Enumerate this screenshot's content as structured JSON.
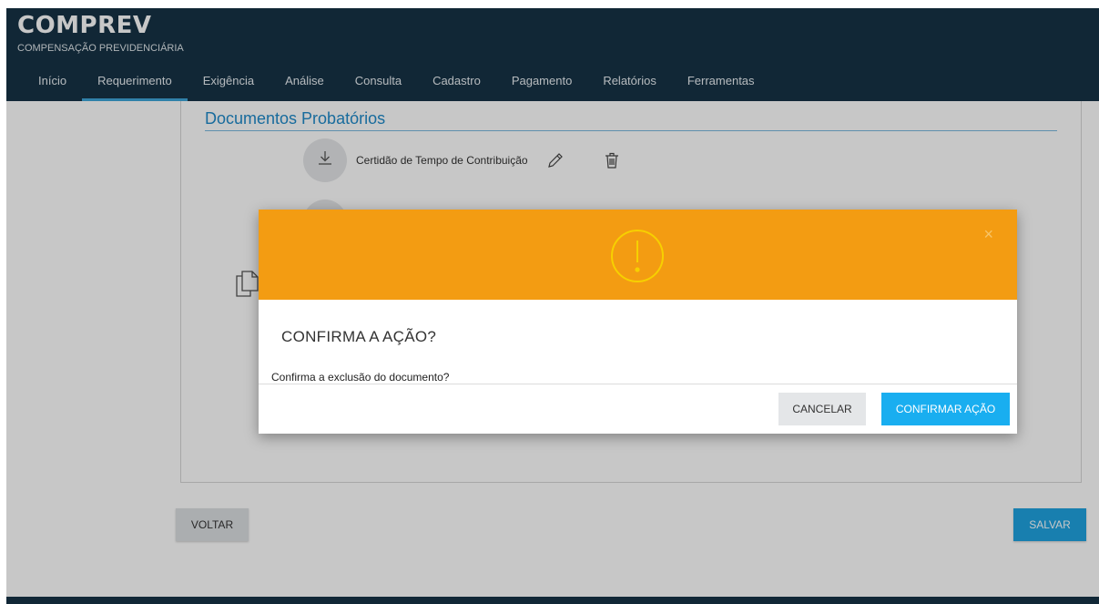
{
  "header": {
    "title": "COMPREV",
    "subtitle": "COMPENSAÇÃO PREVIDENCIÁRIA"
  },
  "nav": {
    "items": [
      {
        "label": "Início"
      },
      {
        "label": "Requerimento"
      },
      {
        "label": "Exigência"
      },
      {
        "label": "Análise"
      },
      {
        "label": "Consulta"
      },
      {
        "label": "Cadastro"
      },
      {
        "label": "Pagamento"
      },
      {
        "label": "Relatórios"
      },
      {
        "label": "Ferramentas"
      }
    ],
    "active": "Requerimento"
  },
  "main": {
    "section_title": "Documentos Probatórios",
    "documents": [
      {
        "label": "Certidão de Tempo de Contribuição",
        "icons": [
          "download-icon",
          "pencil-icon",
          "trash-icon"
        ]
      }
    ],
    "voltar_label": "VOLTAR",
    "salvar_label": "SALVAR"
  },
  "modal": {
    "icon": "warning-icon",
    "close_icon": "close-icon",
    "close_glyph": "×",
    "title": "CONFIRMA A AÇÃO?",
    "message": "Confirma a exclusão do documento?",
    "cancel_label": "CANCELAR",
    "confirm_label": "CONFIRMAR AÇÃO"
  },
  "colors": {
    "header_bg": "#163346",
    "accent_blue": "#1fa3e0",
    "section_title": "#1f8ac9",
    "modal_header": "#f39c12",
    "warning_icon": "#f7d000"
  }
}
